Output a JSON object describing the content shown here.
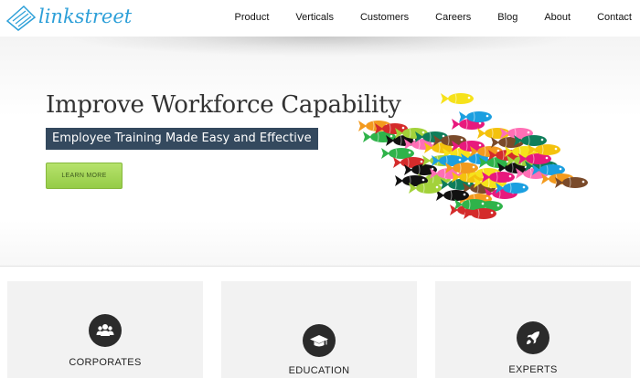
{
  "brand": {
    "name": "linkstreet",
    "accent": "#2c9fd8"
  },
  "nav": {
    "items": [
      "Product",
      "Verticals",
      "Customers",
      "Careers",
      "Blog",
      "About",
      "Contact"
    ]
  },
  "hero": {
    "title": "Improve Workforce Capability",
    "subtitle": "Employee Training Made Easy and Effective",
    "subtitle_bg": "#34495e",
    "cta_label": "LEARN MORE",
    "cta_color": "#95cc47",
    "illustration": "fish-school-arrow"
  },
  "cards": [
    {
      "label": "CORPORATES",
      "icon": "people-icon"
    },
    {
      "label": "EDUCATION",
      "icon": "graduation-cap-icon"
    },
    {
      "label": "EXPERTS",
      "icon": "rocket-icon"
    }
  ]
}
